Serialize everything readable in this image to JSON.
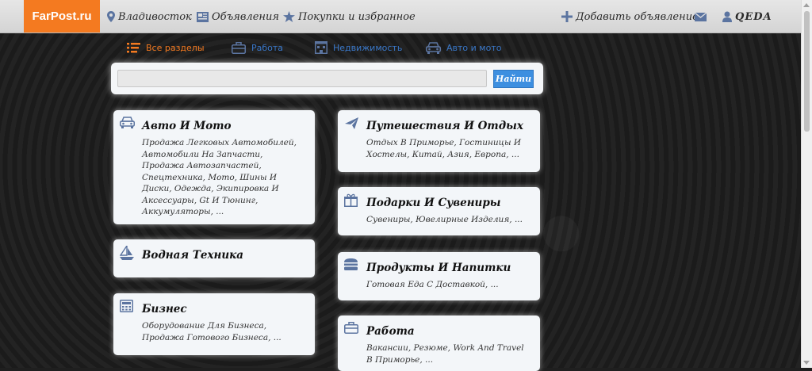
{
  "header": {
    "logo": "FarPost.ru",
    "city": "Владивосток",
    "ads": "Объявления",
    "favorites": "Покупки и избранное",
    "add_ad": "Добавить объявление",
    "user": "QEDA"
  },
  "tabs": [
    {
      "label": "Все разделы",
      "icon": "list-icon"
    },
    {
      "label": "Работа",
      "icon": "briefcase-icon"
    },
    {
      "label": "Недвижимость",
      "icon": "building-icon"
    },
    {
      "label": "Авто и мото",
      "icon": "car-icon"
    }
  ],
  "search": {
    "value": "",
    "button": "Найти"
  },
  "cards": {
    "auto": {
      "title": "Авто И Мото",
      "desc": "Продажа Легковых Автомобилей, Автомобили На Запчасти, Продажа Автозапчастей, Спецтехника, Мото, Шины И Диски, Одежда, Экипировка И Аксессуары, Gt И Тюнинг, Аккумуляторы, ..."
    },
    "water": {
      "title": "Водная Техника",
      "desc": ""
    },
    "business": {
      "title": "Бизнес",
      "desc": "Оборудование Для Бизнеса, Продажа Готового Бизнеса, ..."
    },
    "travel": {
      "title": "Путешествия И Отдых",
      "desc": "Отдых В Приморье, Гостиницы И Хостелы, Китай, Азия, Европа, ..."
    },
    "gifts": {
      "title": "Подарки И Сувениры",
      "desc": "Сувениры, Ювелирные Изделия, ..."
    },
    "food": {
      "title": "Продукты И Напитки",
      "desc": "Готовая Еда С Доставкой, ..."
    },
    "job": {
      "title": "Работа",
      "desc": "Вакансии, Резюме, Work And Travel В Приморье, ..."
    }
  },
  "colors": {
    "accent": "#f47a20",
    "link": "#3a78c9",
    "button": "#3d8fe0",
    "icon": "#5b74a0"
  }
}
